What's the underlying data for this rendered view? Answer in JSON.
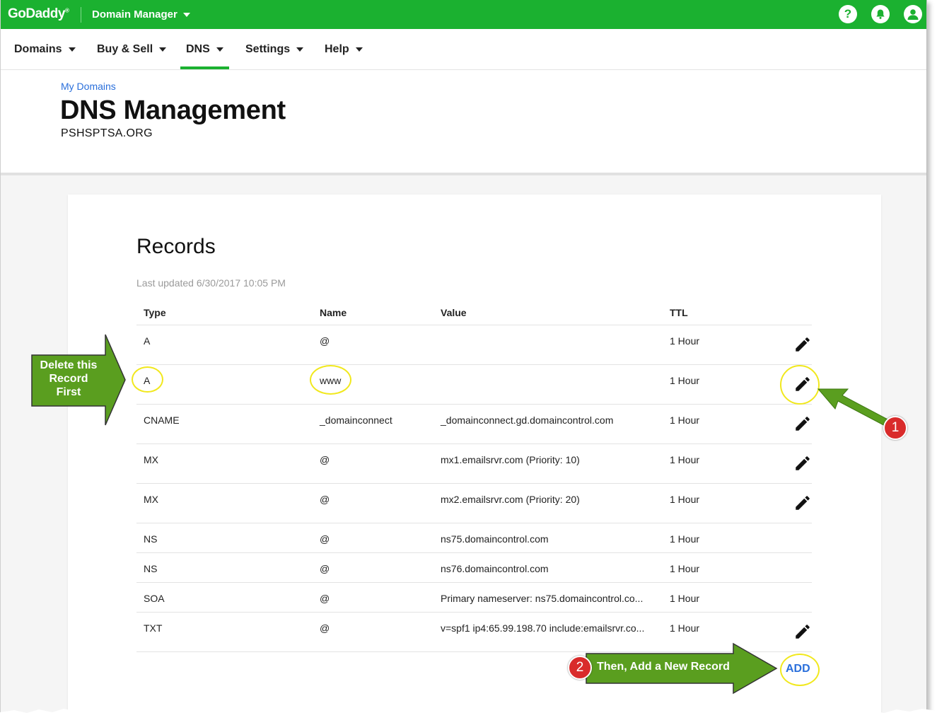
{
  "topbar": {
    "logo": "GoDaddy",
    "app_name": "Domain Manager",
    "bg_color": "#1bb130"
  },
  "nav": {
    "items": [
      {
        "label": "Domains"
      },
      {
        "label": "Buy & Sell"
      },
      {
        "label": "DNS",
        "active": true
      },
      {
        "label": "Settings"
      },
      {
        "label": "Help"
      }
    ]
  },
  "header": {
    "breadcrumb": "My Domains",
    "title": "DNS Management",
    "domain": "PSHSPTSA.ORG"
  },
  "records": {
    "title": "Records",
    "last_updated": "Last updated 6/30/2017 10:05 PM",
    "columns": [
      "Type",
      "Name",
      "Value",
      "TTL"
    ],
    "rows": [
      {
        "type": "A",
        "name": "@",
        "value": "",
        "ttl": "1 Hour",
        "editable": true
      },
      {
        "type": "A",
        "name": "www",
        "value": "",
        "ttl": "1 Hour",
        "editable": true
      },
      {
        "type": "CNAME",
        "name": "_domainconnect",
        "value": "_domainconnect.gd.domaincontrol.com",
        "ttl": "1 Hour",
        "editable": true
      },
      {
        "type": "MX",
        "name": "@",
        "value": "mx1.emailsrvr.com (Priority: 10)",
        "ttl": "1 Hour",
        "editable": true
      },
      {
        "type": "MX",
        "name": "@",
        "value": "mx2.emailsrvr.com (Priority: 20)",
        "ttl": "1 Hour",
        "editable": true
      },
      {
        "type": "NS",
        "name": "@",
        "value": "ns75.domaincontrol.com",
        "ttl": "1 Hour",
        "editable": false
      },
      {
        "type": "NS",
        "name": "@",
        "value": "ns76.domaincontrol.com",
        "ttl": "1 Hour",
        "editable": false
      },
      {
        "type": "SOA",
        "name": "@",
        "value": "Primary nameserver: ns75.domaincontrol.co...",
        "ttl": "1 Hour",
        "editable": false
      },
      {
        "type": "TXT",
        "name": "@",
        "value": "v=spf1 ip4:65.99.198.70 include:emailsrvr.co...",
        "ttl": "1 Hour",
        "editable": true
      }
    ],
    "add_label": "ADD"
  },
  "annotations": {
    "delete_note_line1": "Delete this",
    "delete_note_line2": "Record",
    "delete_note_line3": "First",
    "add_note": "Then, Add a New Record",
    "badge1": "1",
    "badge2": "2",
    "arrow_color": "#5a9e1f",
    "highlight_color": "#f1e81d",
    "badge_color": "#d92b2b"
  }
}
